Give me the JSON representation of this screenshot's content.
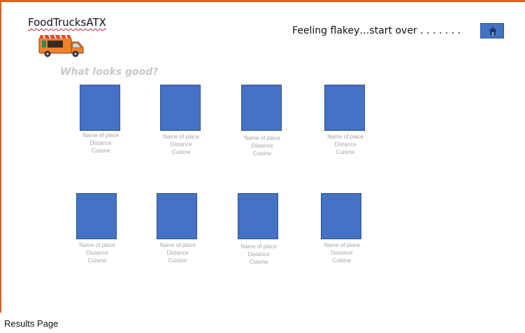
{
  "header": {
    "brand_title": "FoodTrucksATX",
    "start_over_text": "Feeling flakey…start over . . . . . . .",
    "home_button_icon": "home-icon"
  },
  "prompt": "What looks good?",
  "results": [
    {
      "name": "Name of place",
      "distance": "Distance",
      "cuisine": "Cuisine"
    },
    {
      "name": "Name of place",
      "distance": "Distance",
      "cuisine": "Cuisine"
    },
    {
      "name": "Name of place",
      "distance": "Distance",
      "cuisine": "Cuisine"
    },
    {
      "name": "Name of place",
      "distance": "Distance",
      "cuisine": "Cuisine"
    },
    {
      "name": "Name of place",
      "distance": "Distance",
      "cuisine": "Cuisine"
    },
    {
      "name": "Name of place",
      "distance": "Distance",
      "cuisine": "Cuisine"
    },
    {
      "name": "Name of place",
      "distance": "Distance",
      "cuisine": "Cuisine"
    },
    {
      "name": "Name of place",
      "distance": "Distance",
      "cuisine": "Cuisine"
    }
  ],
  "page_label": "Results Page",
  "colors": {
    "frame_border": "#d9631e",
    "placeholder_fill": "#4472c4",
    "placeholder_text": "#a6a6a6"
  }
}
